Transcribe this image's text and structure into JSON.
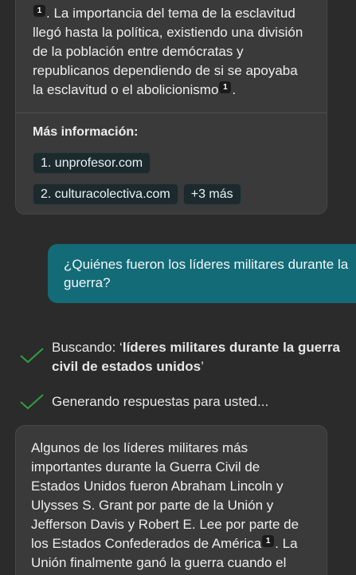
{
  "previous_answer": {
    "text_part1": ". La importancia del tema de la esclavitud llegó hasta la política, existiendo una división de la población entre demócratas y republicanos dependiendo de si se apoyaba la esclavitud o el abolicionismo",
    "text_part2": ".",
    "citation": "1",
    "more_info_label": "Más información:",
    "sources": [
      "1. unprofesor.com",
      "2. culturacolectiva.com"
    ],
    "more_sources": "+3 más"
  },
  "user_message": "¿Quiénes fueron los líderes militares durante la guerra?",
  "status": {
    "searching_prefix": "Buscando: ‘",
    "searching_query": "líderes militares durante la guerra civil de estados unidos",
    "searching_suffix": "’",
    "generating": "Generando respuestas para usted..."
  },
  "answer": {
    "text_part1": "Algunos de los líderes militares más importantes durante la Guerra Civil de Estados Unidos fueron Abraham Lincoln y Ulysses S. Grant por parte de la Unión y Jefferson Davis y Robert E. Lee por parte de los Estados Confederados de América",
    "citation": "1",
    "text_part2": ". La Unión finalmente ganó la guerra cuando el"
  },
  "colors": {
    "background": "#2b2b2b",
    "card": "#3a3a3a",
    "user_bubble": "#136b77",
    "check": "#2ea043",
    "chip": "#1c2a2e"
  }
}
